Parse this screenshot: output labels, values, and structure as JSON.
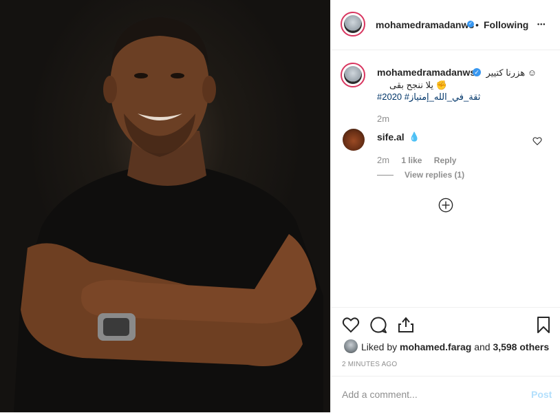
{
  "post": {
    "username": "mohamedramadanws",
    "verified_mark": "✓",
    "separator": "•",
    "follow_status": "Following",
    "more_label": "•••"
  },
  "caption": {
    "username": "mohamedramadanws",
    "line1": "هزرنا كتيير ☺",
    "line2": "يلا ننجح بقى ✊",
    "hashtags": "#2020 #ثقة_في_الله_إمتياز",
    "time": "2m"
  },
  "comment": {
    "username": "sife.al",
    "text": "💧",
    "time": "2m",
    "likes": "1 like",
    "reply_label": "Reply",
    "view_replies": "View replies (1)"
  },
  "likes": {
    "prefix": "Liked by",
    "user": "mohamed.farag",
    "mid": "and",
    "others": "3,598 others",
    "time_ago": "2 MINUTES AGO"
  },
  "composer": {
    "placeholder": "Add a comment...",
    "post_label": "Post"
  },
  "icons": [
    "more-icon",
    "verified-icon",
    "heart-icon",
    "comment-icon",
    "share-icon",
    "bookmark-icon",
    "plus-circle-icon"
  ]
}
